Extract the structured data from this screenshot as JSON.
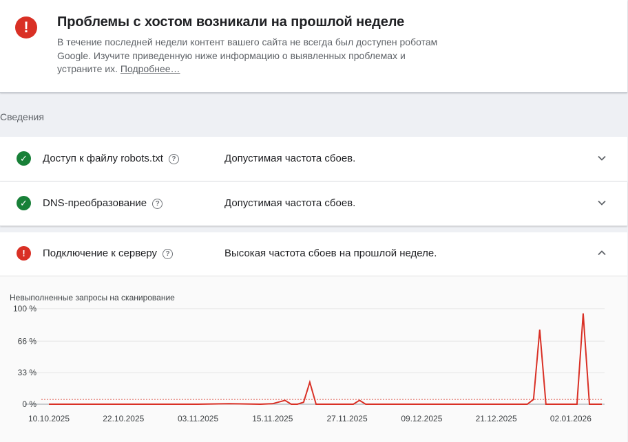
{
  "alert": {
    "icon": "error-icon",
    "title": "Проблемы с хостом возникали на прошлой неделе",
    "description": "В течение последней недели контент вашего сайта не всегда был доступен роботам Google. Изучите приведенную ниже информацию о выявленных проблемах и устраните их.",
    "link": "Подробнее…"
  },
  "section": {
    "label": "Сведения"
  },
  "rows": [
    {
      "name": "Доступ к файлу robots.txt",
      "status": "Допустимая частота сбоев.",
      "state": "ok",
      "icon": "check-circle-icon",
      "expanded": false
    },
    {
      "name": "DNS-преобразование",
      "status": "Допустимая частота сбоев.",
      "state": "ok",
      "icon": "check-circle-icon",
      "expanded": false
    },
    {
      "name": "Подключение к серверу",
      "status": "Высокая частота сбоев на прошлой неделе.",
      "state": "error",
      "icon": "error-icon",
      "expanded": true
    }
  ],
  "colors": {
    "ok": "#188038",
    "error": "#d93025",
    "line": "#d93025",
    "threshold": "#e06055"
  },
  "chart_data": {
    "type": "line",
    "title": "Невыполненные запросы на сканирование",
    "xlabel": "",
    "ylabel": "",
    "ylim": [
      0,
      100
    ],
    "y_ticks": [
      "0 %",
      "33 %",
      "66 %",
      "100 %"
    ],
    "y_tick_values": [
      0,
      33,
      66,
      100
    ],
    "x_ticks": [
      "10.10.2025",
      "22.10.2025",
      "03.11.2025",
      "15.11.2025",
      "27.11.2025",
      "09.12.2025",
      "21.12.2025",
      "02.01.2026"
    ],
    "threshold": 5,
    "grid": true,
    "series": [
      {
        "x": [
          "10.10.2025",
          "18.10.2025",
          "26.10.2025",
          "03.11.2025",
          "08.11.2025",
          "13.11.2025",
          "15.11.2025",
          "17.11.2025",
          "18.11.2025",
          "19.11.2025",
          "20.11.2025",
          "21.11.2025",
          "22.11.2025",
          "23.11.2025",
          "24.11.2025",
          "25.11.2025",
          "26.11.2025",
          "27.11.2025",
          "28.11.2025",
          "29.11.2025",
          "30.11.2025",
          "01.12.2025",
          "02.12.2025",
          "09.12.2025",
          "15.12.2025",
          "21.12.2025",
          "25.12.2025",
          "26.12.2025",
          "27.12.2025",
          "28.12.2025",
          "29.12.2025",
          "30.12.2025",
          "31.12.2025",
          "01.01.2026",
          "02.01.2026",
          "03.01.2026",
          "04.01.2026",
          "05.01.2026",
          "06.01.2026",
          "07.01.2026"
        ],
        "values": [
          0,
          0,
          0,
          0,
          0.5,
          0,
          0.5,
          4,
          0,
          0,
          2,
          23,
          0,
          0,
          0,
          0,
          0,
          0,
          0,
          4,
          0,
          0,
          0,
          0,
          0,
          0,
          0,
          0,
          5,
          78,
          0,
          0,
          0,
          0,
          0,
          0,
          95,
          0,
          0,
          0
        ]
      }
    ]
  }
}
